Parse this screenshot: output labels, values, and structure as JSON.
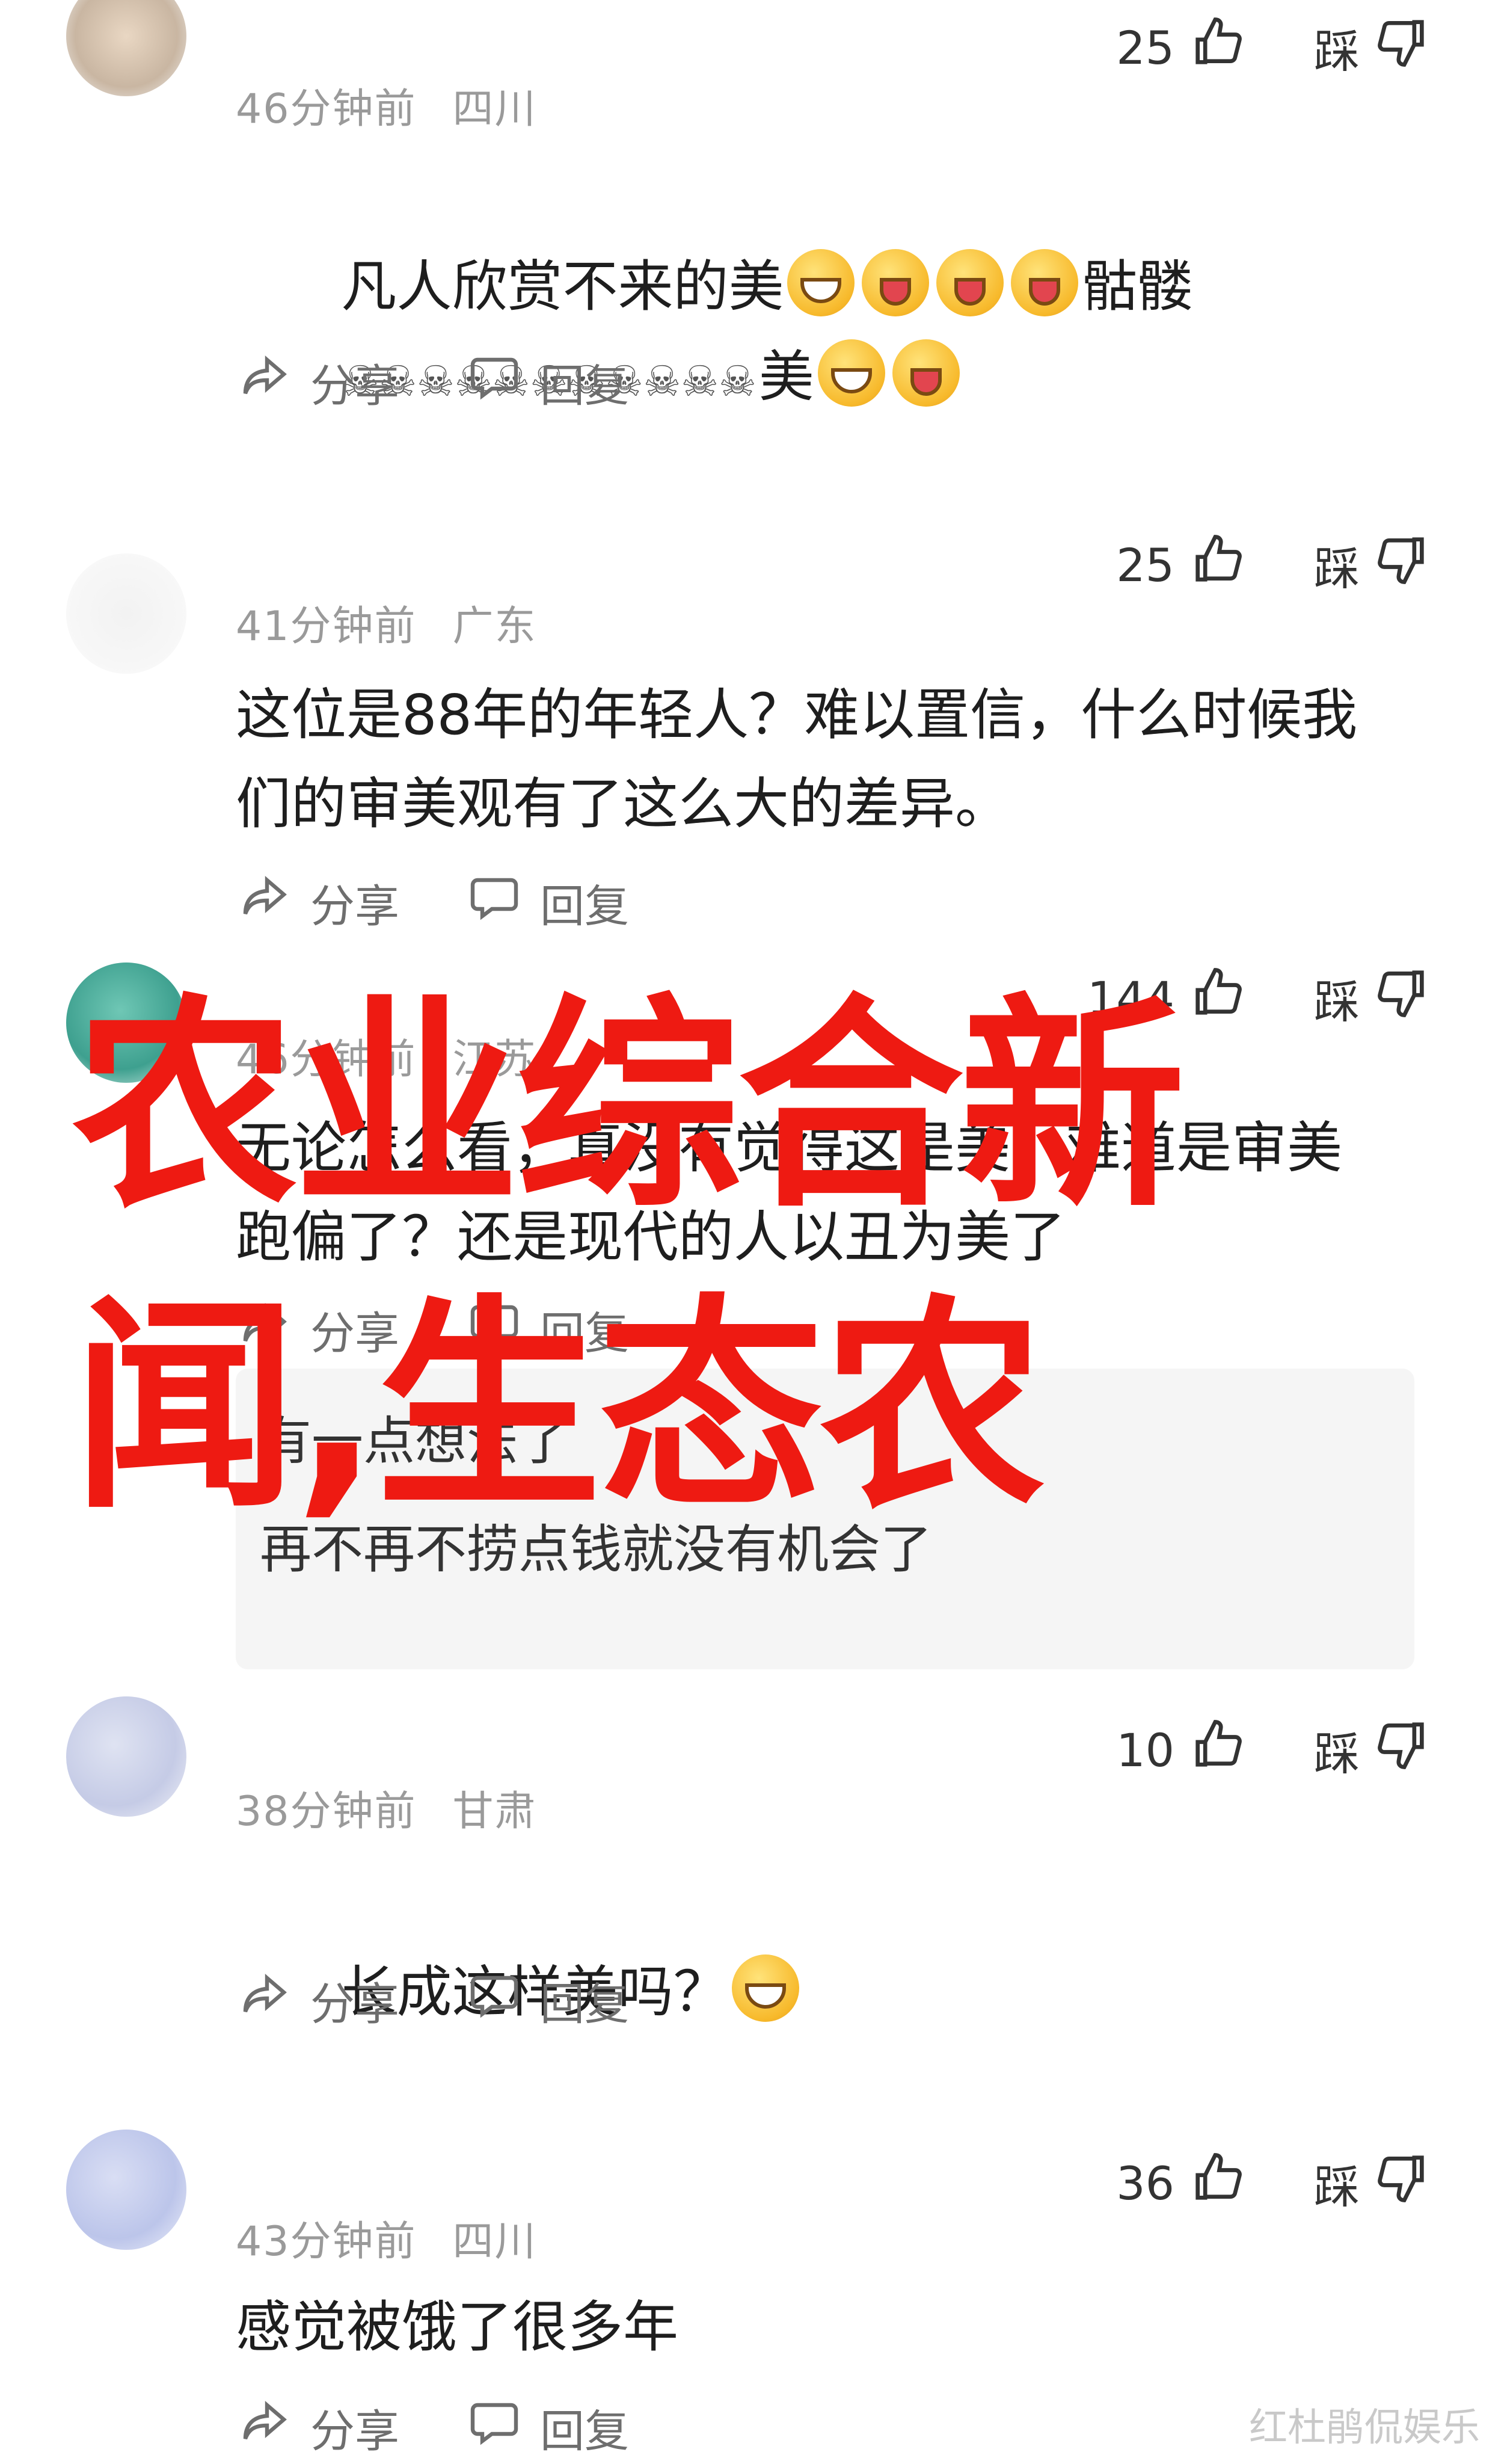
{
  "comments": [
    {
      "username": "",
      "time": "46分钟前",
      "location": "四川",
      "text_line1": "凡人欣赏不来的美",
      "text_line1_tail": "骷髅",
      "text_line2_tail": "美",
      "likes": "25",
      "dislike_label": "踩",
      "share_label": "分享",
      "reply_label": "回复"
    },
    {
      "username": "",
      "time": "41分钟前",
      "location": "广东",
      "text": "这位是88年的年轻人？难以置信，什么时候我\n们的审美观有了这么大的差异。",
      "likes": "25",
      "dislike_label": "踩",
      "share_label": "分享",
      "reply_label": "回复"
    },
    {
      "username": "",
      "time": "46分钟前",
      "location": "江苏",
      "text": "无论怎么看，真没有觉得这是美，难道是审美\n跑偏了？还是现代的人以丑为美了",
      "likes": "144",
      "dislike_label": "踩",
      "share_label": "分享",
      "reply_label": "回复",
      "replies": [
        "有一点想法了",
        "再不再不捞点钱就没有机会了"
      ]
    },
    {
      "username": "",
      "time": "38分钟前",
      "location": "甘肃",
      "text": "长成这样美吗？",
      "likes": "10",
      "dislike_label": "踩",
      "share_label": "分享",
      "reply_label": "回复"
    },
    {
      "username": "",
      "time": "43分钟前",
      "location": "四川",
      "text": "感觉被饿了很多年",
      "likes": "36",
      "dislike_label": "踩",
      "share_label": "分享",
      "reply_label": "回复"
    }
  ],
  "overlay_title": "农业综合新闻,生态农",
  "watermark": "红杜鹃侃娱乐",
  "colors": {
    "overlay": "#ee1a12",
    "meta": "#9a9a9a",
    "action": "#6e6e6e"
  }
}
